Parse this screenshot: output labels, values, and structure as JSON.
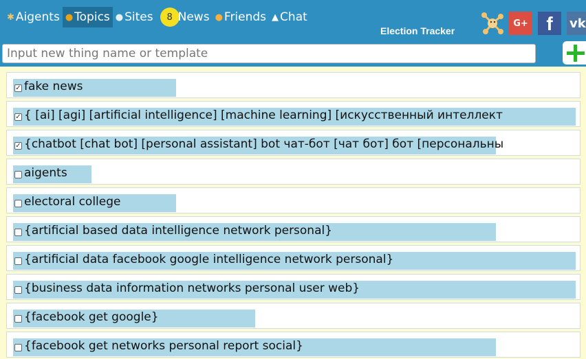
{
  "nav": {
    "items": [
      {
        "icon": "✱",
        "label": "Aigents",
        "active": false
      },
      {
        "icon": "●",
        "label": "Topics",
        "active": true
      },
      {
        "icon": "●",
        "label": "Sites",
        "active": false
      },
      {
        "badge": "8",
        "label": "News",
        "active": false
      },
      {
        "icon": "●",
        "label": "Friends",
        "active": false
      },
      {
        "icon": "▲",
        "label": "Chat",
        "active": false
      }
    ]
  },
  "header": {
    "tracker_label": "Election Tracker",
    "social": {
      "gplus": "G+",
      "facebook": "f",
      "vk": "vk"
    }
  },
  "search": {
    "placeholder": "Input new thing name or template",
    "value": ""
  },
  "colors": {
    "header": "#2e8fc0",
    "highlight": "#acd7e6",
    "background": "#fdfbd2",
    "add": "#2ab52a"
  },
  "topics": [
    {
      "label": "fake news",
      "checked": true
    },
    {
      "label": "{ [ai] [agi] [artificial intelligence] [machine learning] [искусственный интеллект",
      "checked": true
    },
    {
      "label": "{chatbot [chat bot] [personal assistant] bot чат-бот [чат бот] бот [персональны",
      "checked": true
    },
    {
      "label": "aigents",
      "checked": false
    },
    {
      "label": "electoral college",
      "checked": false
    },
    {
      "label": "{artificial based data intelligence network personal}",
      "checked": false
    },
    {
      "label": "{artificial data facebook google intelligence network personal}",
      "checked": false
    },
    {
      "label": "{business data information networks personal user web}",
      "checked": false
    },
    {
      "label": "{facebook get google}",
      "checked": false
    },
    {
      "label": "{facebook get networks personal report social}",
      "checked": false
    }
  ]
}
